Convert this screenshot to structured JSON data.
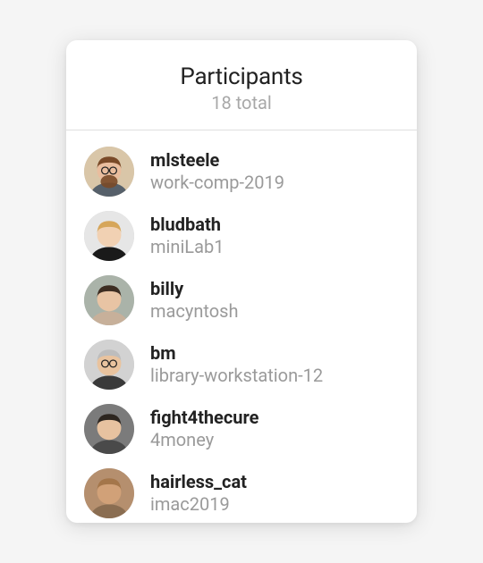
{
  "header": {
    "title": "Participants",
    "subtitle": "18 total"
  },
  "participants": [
    {
      "username": "mlsteele",
      "device": "work-comp-2019",
      "avatar": {
        "bg": "#d9c6a8",
        "skin": "#e9bd9e",
        "hair": "#7a4a28",
        "shirt": "#56606a",
        "beard": true,
        "glasses": true
      }
    },
    {
      "username": "bludbath",
      "device": "miniLab1",
      "avatar": {
        "bg": "#e6e6e6",
        "skin": "#f1d1b3",
        "hair": "#d6a65a",
        "shirt": "#1a1a1a",
        "beard": false,
        "glasses": false
      }
    },
    {
      "username": "billy",
      "device": "macyntosh",
      "avatar": {
        "bg": "#aab3a9",
        "skin": "#e8c4a4",
        "hair": "#3d2d22",
        "shirt": "#c7b09a",
        "beard": false,
        "glasses": false
      }
    },
    {
      "username": "bm",
      "device": "library-workstation-12",
      "avatar": {
        "bg": "#d2d2d2",
        "skin": "#e9c39e",
        "hair": "#bdbdbd",
        "shirt": "#3a3a3a",
        "beard": false,
        "glasses": true
      }
    },
    {
      "username": "fight4thecure",
      "device": "4money",
      "avatar": {
        "bg": "#7b7b7b",
        "skin": "#e7c2a0",
        "hair": "#2d2620",
        "shirt": "#4a4a4a",
        "beard": false,
        "glasses": false
      }
    },
    {
      "username": "hairless_cat",
      "device": "imac2019",
      "avatar": {
        "bg": "#b58f6e",
        "skin": "#d1a178",
        "hair": "#a4764a",
        "shirt": "#8a6d51",
        "beard": false,
        "glasses": false
      }
    }
  ]
}
